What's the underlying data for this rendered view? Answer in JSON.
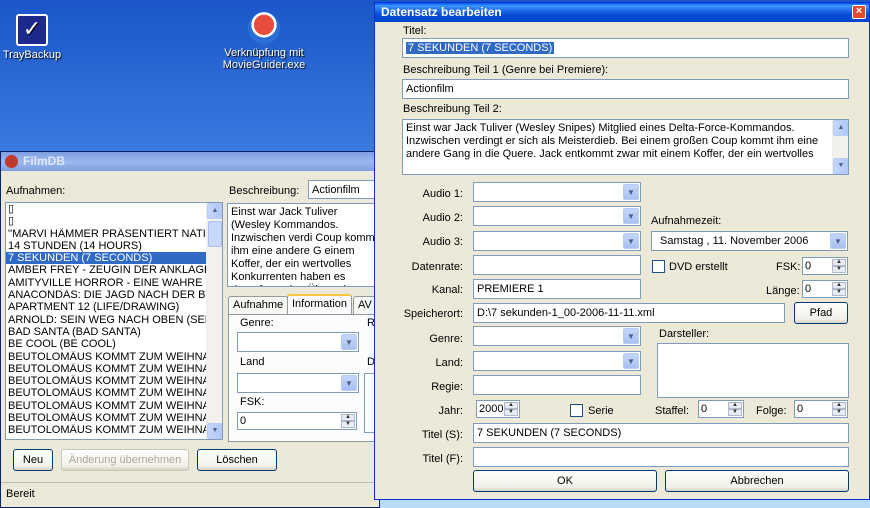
{
  "desktop": {
    "icons": [
      {
        "label": "TrayBackup"
      },
      {
        "label": "Verknüpfung mit MovieGuider.exe"
      }
    ]
  },
  "filmdb": {
    "title": "FilmDB",
    "aufnahmen_label": "Aufnahmen:",
    "list": [
      "▯",
      "▯",
      "''MARVI HÄMMER PRÄSENTIERT NATI",
      "14 STUNDEN (14 HOURS)",
      "7 SEKUNDEN (7 SECONDS)",
      "AMBER FREY - ZEUGIN DER ANKLAGE",
      "AMITYVILLE HORROR - EINE WAHRE G",
      "ANACONDAS: DIE JAGD NACH DER BL",
      "APARTMENT 12 (LIFE/DRAWING)",
      "ARNOLD: SEIN WEG NACH OBEN (SEE",
      "BAD SANTA (BAD SANTA)",
      "BE COOL (BE COOL)",
      "BEUTOLOMÄUS KOMMT ZUM WEIHNA",
      "BEUTOLOMÄUS KOMMT ZUM WEIHNA",
      "BEUTOLOMÄUS KOMMT ZUM WEIHNA",
      "BEUTOLOMÄUS KOMMT ZUM WEIHNA",
      "BEUTOLOMÄUS KOMMT ZUM WEIHNA",
      "BEUTOLOMÄUS KOMMT ZUM WEIHNA",
      "BEUTOLOMÄUS KOMMT ZUM WEIHNA"
    ],
    "selected_index": 4,
    "beschreibung_label": "Beschreibung:",
    "beschreibung_value": "Actionfilm",
    "desc_text": "Einst war Jack Tuliver (Wesley Kommandos. Inzwischen verdi Coup kommt ihm eine andere G einem Koffer, der ein wertvolles Konkurrenten haben es darauf um eine Übergabe zu erzwinge Knallharte Action mit \"Blade\" S",
    "tabs": [
      "Aufnahme",
      "Information",
      "AV"
    ],
    "genre_label": "Genre:",
    "land_label": "Land",
    "fsk_label": "FSK:",
    "fsk_value": "0",
    "r_label": "R",
    "d_label": "D",
    "btn_neu": "Neu",
    "btn_aenderung": "Änderung übernehmen",
    "btn_loeschen": "Löschen",
    "status": "Bereit"
  },
  "dialog": {
    "title": "Datensatz bearbeiten",
    "titel_label": "Titel:",
    "titel_value": "7 SEKUNDEN (7 SECONDS)",
    "beschr1_label": "Beschreibung Teil 1 (Genre bei Premiere):",
    "beschr1_value": "Actionfilm",
    "beschr2_label": "Beschreibung Teil 2:",
    "beschr2_value": "Einst war Jack Tuliver (Wesley Snipes) Mitglied eines Delta-Force-Kommandos. Inzwischen verdingt er sich als Meisterdieb. Bei einem großen Coup kommt ihm eine andere Gang in die Quere. Jack entkommt zwar mit einem Koffer, der ein wertvolles",
    "audio1_label": "Audio 1:",
    "audio2_label": "Audio 2:",
    "audio3_label": "Audio 3:",
    "aufnahmezeit_label": "Aufnahmezeit:",
    "aufnahmezeit_value": "Samstag   , 11. November 2006",
    "datenrate_label": "Datenrate:",
    "dvd_label": "DVD erstellt",
    "fsk_label": "FSK:",
    "fsk_value": "0",
    "kanal_label": "Kanal:",
    "kanal_value": "PREMIERE 1",
    "laenge_label": "Länge:",
    "laenge_value": "0",
    "speicherort_label": "Speicherort:",
    "speicherort_value": "D:\\7 sekunden-1_00-2006-11-11.xml",
    "pfad_button": "Pfad",
    "genre_label": "Genre:",
    "land_label": "Land:",
    "regie_label": "Regie:",
    "darsteller_label": "Darsteller:",
    "jahr_label": "Jahr:",
    "jahr_value": "2000",
    "serie_label": "Serie",
    "staffel_label": "Staffel:",
    "staffel_value": "0",
    "folge_label": "Folge:",
    "folge_value": "0",
    "titel_s_label": "Titel (S):",
    "titel_s_value": "7 SEKUNDEN (7 SECONDS)",
    "titel_f_label": "Titel (F):",
    "titel_f_value": "",
    "ok_button": "OK",
    "abbrechen_button": "Abbrechen"
  }
}
